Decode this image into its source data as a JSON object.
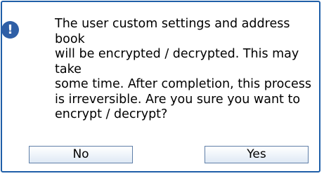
{
  "dialog": {
    "icon": "exclamation-icon",
    "message": "The user custom settings and address book\nwill be encrypted / decrypted. This may take\nsome time. After completion, this process\nis irreversible. Are you sure you want to\nencrypt / decrypt?",
    "no_label": "No",
    "yes_label": "Yes"
  },
  "colors": {
    "border": "#1f5fa8",
    "icon": "#2f5fa6",
    "button_border": "#5f7fa8"
  }
}
